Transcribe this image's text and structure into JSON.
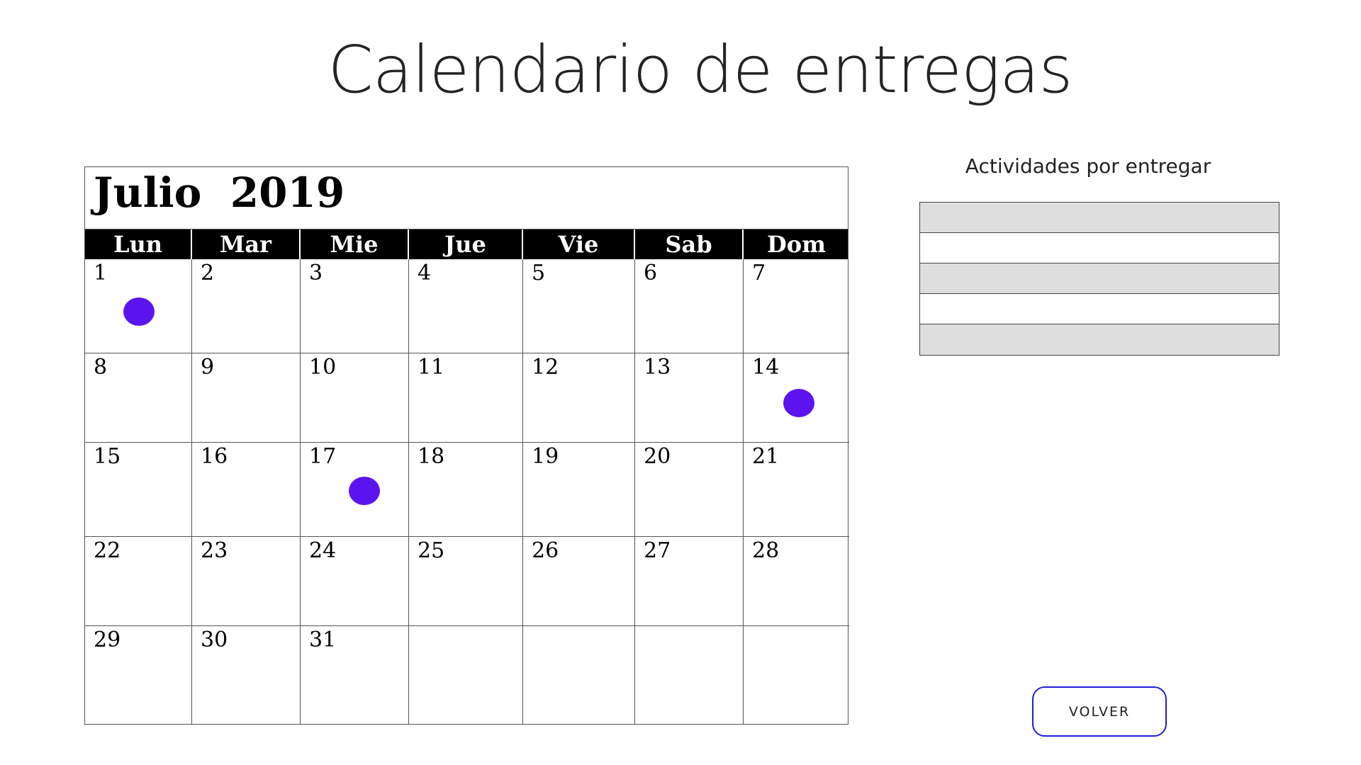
{
  "page": {
    "title": "Calendario de entregas"
  },
  "calendar": {
    "month_label": "Julio  2019",
    "weekdays": [
      "Lun",
      "Mar",
      "Mie",
      "Jue",
      "Vie",
      "Sab",
      "Dom"
    ],
    "cells": [
      "1",
      "2",
      "3",
      "4",
      "5",
      "6",
      "7",
      "8",
      "9",
      "10",
      "11",
      "12",
      "13",
      "14",
      "15",
      "16",
      "17",
      "18",
      "19",
      "20",
      "21",
      "22",
      "23",
      "24",
      "25",
      "26",
      "27",
      "28",
      "29",
      "30",
      "31",
      "",
      "",
      "",
      ""
    ],
    "marked_days": [
      "1",
      "14",
      "17"
    ],
    "marker_color": "#5b14f0"
  },
  "sidebar": {
    "title": "Actividades por entregar",
    "rows": [
      "",
      "",
      "",
      "",
      ""
    ]
  },
  "actions": {
    "back_label": "VOLVER",
    "back_border_color": "#1f1fd8"
  }
}
